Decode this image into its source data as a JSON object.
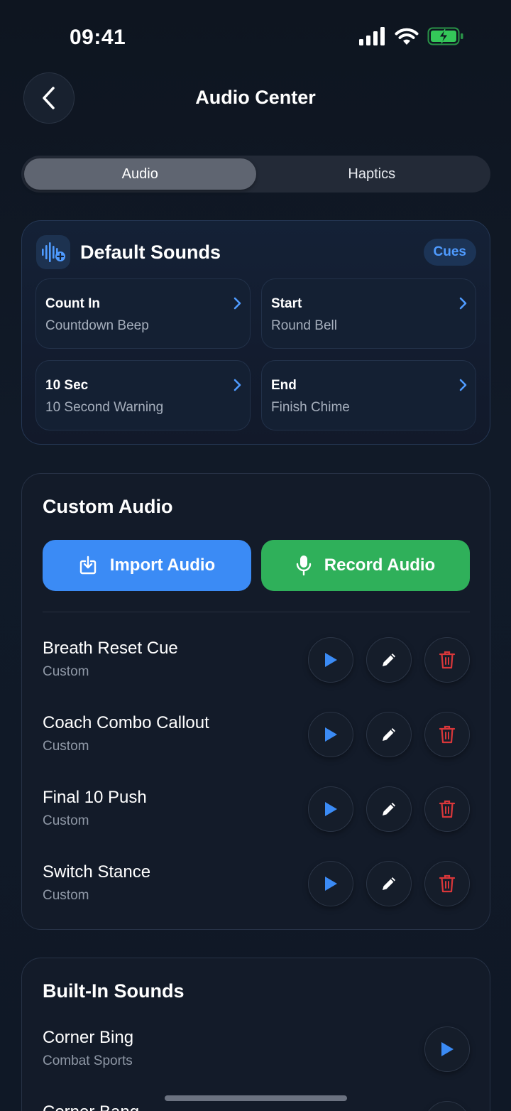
{
  "status_bar": {
    "time": "09:41"
  },
  "header": {
    "title": "Audio Center"
  },
  "tabs": [
    {
      "label": "Audio",
      "active": true
    },
    {
      "label": "Haptics",
      "active": false
    }
  ],
  "default_sounds": {
    "title": "Default Sounds",
    "badge": "Cues",
    "cues": [
      {
        "label": "Count In",
        "value": "Countdown Beep"
      },
      {
        "label": "Start",
        "value": "Round Bell"
      },
      {
        "label": "10 Sec",
        "value": "10 Second Warning"
      },
      {
        "label": "End",
        "value": "Finish Chime"
      }
    ]
  },
  "custom_audio": {
    "title": "Custom Audio",
    "import_label": "Import Audio",
    "record_label": "Record Audio",
    "items": [
      {
        "name": "Breath Reset Cue",
        "type": "Custom"
      },
      {
        "name": "Coach Combo Callout",
        "type": "Custom"
      },
      {
        "name": "Final 10 Push",
        "type": "Custom"
      },
      {
        "name": "Switch Stance",
        "type": "Custom"
      }
    ]
  },
  "built_in_sounds": {
    "title": "Built-In Sounds",
    "items": [
      {
        "name": "Corner Bing",
        "category": "Combat Sports"
      },
      {
        "name": "Corner Bang",
        "category": ""
      }
    ]
  },
  "colors": {
    "accent_blue": "#3b8bf5",
    "accent_green": "#2fb05a",
    "danger_red": "#d9373a",
    "battery_green": "#34c759"
  },
  "icons": {
    "back": "chevron-left-icon",
    "default_sounds": "waveform-plus-icon",
    "import": "download-tray-icon",
    "record": "microphone-icon",
    "play": "play-icon",
    "edit": "pencil-icon",
    "delete": "trash-icon"
  }
}
